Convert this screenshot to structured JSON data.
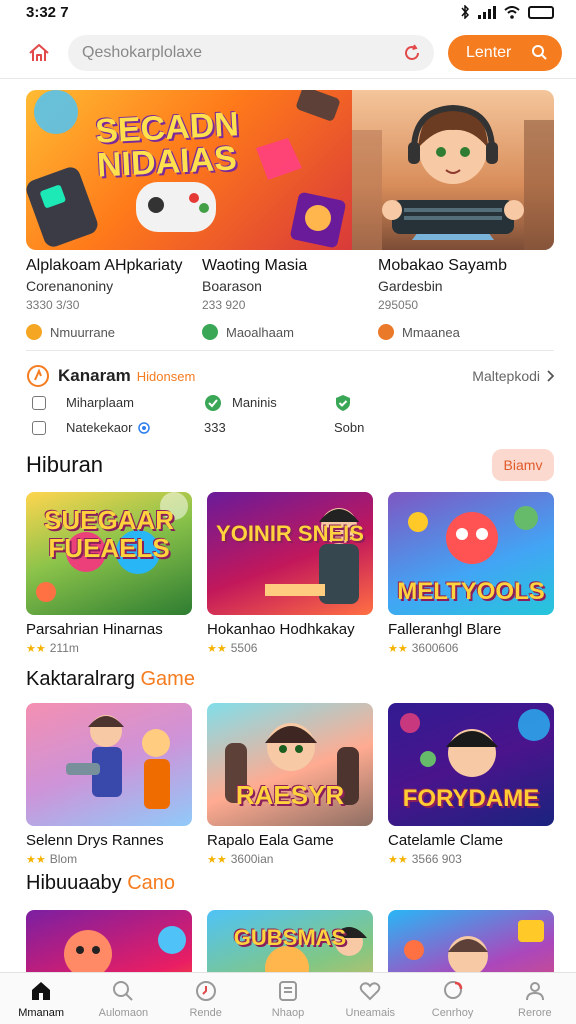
{
  "status": {
    "time": "3:32 7"
  },
  "header": {
    "search_placeholder": "Qeshokarplolaxe",
    "cta_label": "Lenter"
  },
  "featured": {
    "banner_title": "SECADN NIDAIAS",
    "items": [
      {
        "title": "Alplakoam AHpkariaty",
        "subtitle": "Corenanoniny",
        "meta": "3330 3/30",
        "tag": "Nmuurrane",
        "tag_color": "#f5a623"
      },
      {
        "title": "Waoting Masia",
        "subtitle": "Boarason",
        "meta": "233 920",
        "tag": "Maoalhaam",
        "tag_color": "#3aa757"
      },
      {
        "title": "Mobakao Sayamb",
        "subtitle": "Gardesbin",
        "meta": "295050",
        "tag": "Mmaanea",
        "tag_color": "#ea7a2a"
      }
    ]
  },
  "ranking": {
    "title": "Kanaram",
    "subtitle": "Hidonsem",
    "more_label": "Maltepkodi",
    "rows": [
      {
        "col1": "Miharplaam",
        "col2": "Maninis",
        "col3": ""
      },
      {
        "col1": "Natekekaor",
        "col2": "333",
        "col3": "Sobn"
      }
    ]
  },
  "sections": [
    {
      "title": "Hiburan",
      "title_accent": "",
      "button_label": "Biamv",
      "cards": [
        {
          "word": "SUEGAAR FUEAELS",
          "name": "Parsahrian Hinarnas",
          "meta": "211m"
        },
        {
          "word": "YOINIR SNEIS",
          "name": "Hokanhao Hodhkakay",
          "meta": "5506"
        },
        {
          "word": "MELTYOOLS",
          "name": "Falleranhgl Blare",
          "meta": "3600606"
        }
      ]
    },
    {
      "title": "Kaktaralrarg",
      "title_accent": "Game",
      "button_label": "",
      "cards": [
        {
          "word": "",
          "name": "Selenn Drys Rannes",
          "meta": "Blom"
        },
        {
          "word": "RAESYR",
          "name": "Rapalo Eala Game",
          "meta": "3600ian"
        },
        {
          "word": "FORYDAME",
          "name": "Catelamle Clame",
          "meta": "3566 903"
        }
      ]
    },
    {
      "title": "Hibuuaaby",
      "title_accent": "Cano",
      "button_label": "",
      "cards": [
        {
          "word": ""
        },
        {
          "word": "GUBSMAS"
        },
        {
          "word": ""
        }
      ]
    }
  ],
  "bottom_nav": [
    {
      "label": "Mmanam",
      "icon": "home-icon"
    },
    {
      "label": "Aulomaon",
      "icon": "search-icon"
    },
    {
      "label": "Rende",
      "icon": "clock-icon"
    },
    {
      "label": "Nhaop",
      "icon": "tablet-icon"
    },
    {
      "label": "Uneamais",
      "icon": "heart-icon"
    },
    {
      "label": "Cenrhoy",
      "icon": "chat-icon"
    },
    {
      "label": "Rerore",
      "icon": "person-icon"
    }
  ],
  "colors": {
    "accent": "#f57c1f",
    "brand_red": "#e24a4a"
  }
}
